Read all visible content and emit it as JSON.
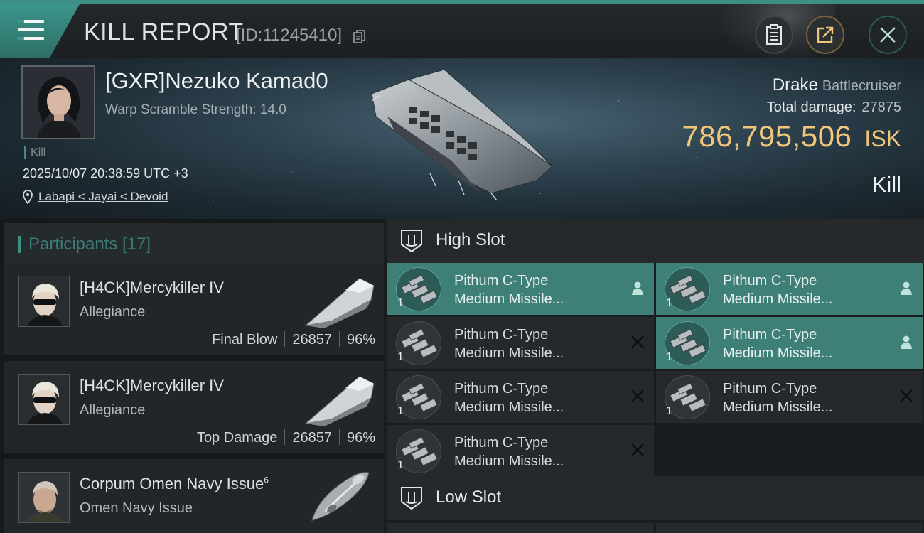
{
  "header": {
    "title": "KILL REPORT",
    "report_id": "[ID:11245410]",
    "icons": [
      "menu-icon",
      "copy-icon",
      "clipboard-icon",
      "share-icon",
      "close-icon"
    ]
  },
  "victim": {
    "pilot_name": "[GXR]Nezuko Kamad0",
    "warp_scramble": "Warp Scramble Strength: 14.0",
    "tag": "Kill",
    "datetime": "2025/10/07 20:38:59 UTC +3",
    "location": "Labapi < Jayai < Devoid",
    "ship_name": "Drake",
    "ship_class": "Battlecruiser",
    "total_damage_label": "Total damage:",
    "total_damage": "27875",
    "isk_value": "786,795,506",
    "isk_currency": "ISK",
    "result": "Kill"
  },
  "participants": {
    "label": "Participants [17]",
    "items": [
      {
        "name": "[H4CK]Mercykiller IV",
        "ship": "Allegiance",
        "role": "Final Blow",
        "damage": "26857",
        "percent": "96%"
      },
      {
        "name": "[H4CK]Mercykiller IV",
        "ship": "Allegiance",
        "role": "Top Damage",
        "damage": "26857",
        "percent": "96%"
      },
      {
        "name": "Corpum Omen Navy Issue",
        "name_sup": "6",
        "ship": "Omen Navy Issue"
      }
    ]
  },
  "slots": {
    "high": {
      "label": "High Slot",
      "modules": [
        {
          "line1": "Pithum C-Type",
          "line2": "Medium Missile...",
          "qty": "1",
          "state": "fitted"
        },
        {
          "line1": "Pithum C-Type",
          "line2": "Medium Missile...",
          "qty": "1",
          "state": "fitted"
        },
        {
          "line1": "Pithum C-Type",
          "line2": "Medium Missile...",
          "qty": "1",
          "state": "destroyed"
        },
        {
          "line1": "Pithum C-Type",
          "line2": "Medium Missile...",
          "qty": "1",
          "state": "fitted"
        },
        {
          "line1": "Pithum C-Type",
          "line2": "Medium Missile...",
          "qty": "1",
          "state": "destroyed"
        },
        {
          "line1": "Pithum C-Type",
          "line2": "Medium Missile...",
          "qty": "1",
          "state": "destroyed"
        },
        {
          "line1": "Pithum C-Type",
          "line2": "Medium Missile...",
          "qty": "1",
          "state": "destroyed"
        }
      ]
    },
    "low": {
      "label": "Low Slot"
    }
  },
  "colors": {
    "accent": "#3d8f86",
    "isk": "#f0c77a",
    "fitted_bg": "#3e7f77"
  }
}
